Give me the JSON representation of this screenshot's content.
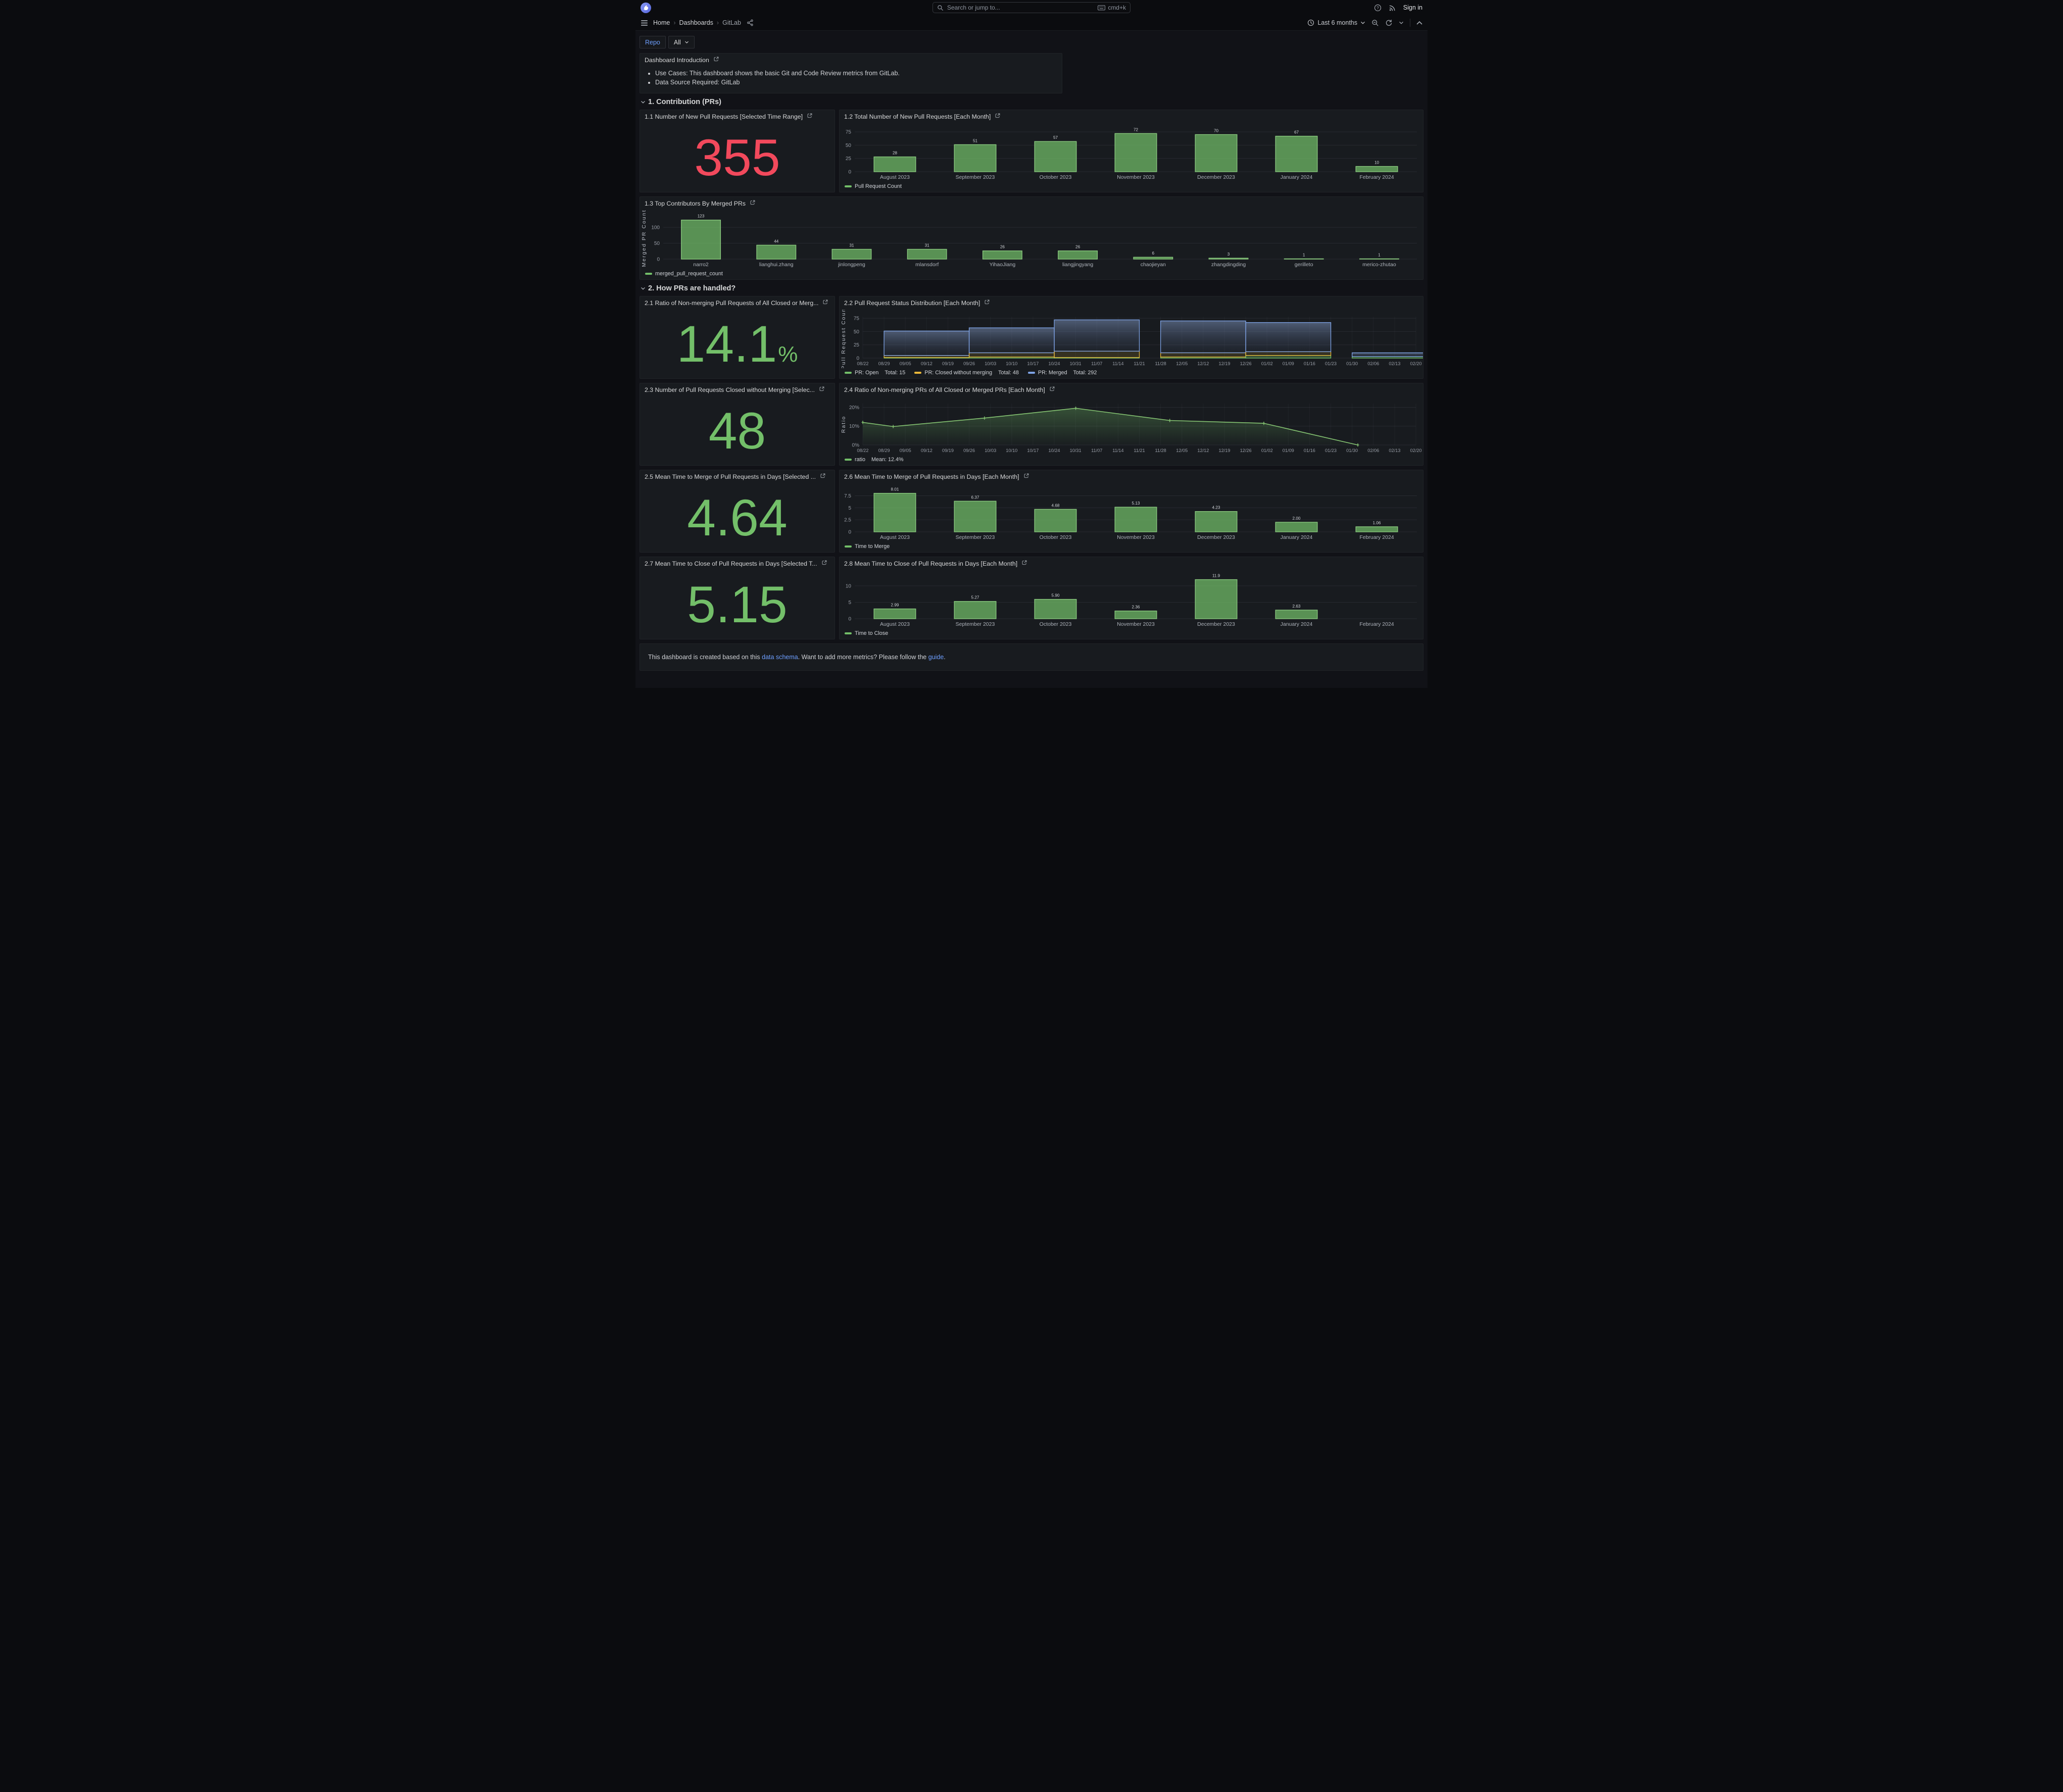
{
  "theme": {
    "page_bg": "#111217",
    "panel_bg": "#181b1f",
    "accent_blue": "#6E9FFF",
    "stat_red": "#F2495C",
    "stat_green": "#73BF69",
    "yellow": "#EAB839",
    "blue_series": "#7EA3E6"
  },
  "topnav": {
    "search_placeholder": "Search or jump to...",
    "shortcut": "cmd+k",
    "sign_in": "Sign in"
  },
  "breadcrumb": {
    "items": [
      "Home",
      "Dashboards",
      "GitLab"
    ]
  },
  "toolbar": {
    "time_range": "Last 6 months"
  },
  "filters": {
    "label": "Repo",
    "value": "All"
  },
  "intro": {
    "title": "Dashboard Introduction",
    "bullets": [
      "Use Cases: This dashboard shows the basic Git and Code Review metrics from GitLab.",
      "Data Source Required: GitLab"
    ]
  },
  "sections": {
    "s1": "1. Contribution (PRs)",
    "s2": "2. How PRs are handled?"
  },
  "stats": {
    "p11": {
      "title": "1.1 Number of New Pull Requests [Selected Time Range]",
      "value": "355"
    },
    "p21": {
      "title": "2.1 Ratio of Non-merging Pull Requests of All Closed or Merg...",
      "value": "14.1",
      "suffix": "%"
    },
    "p23": {
      "title": "2.3 Number of Pull Requests Closed without Merging [Selec...",
      "value": "48"
    },
    "p25": {
      "title": "2.5 Mean Time to Merge of Pull Requests in Days [Selected ...",
      "value": "4.64"
    },
    "p27": {
      "title": "2.7 Mean Time to Close of Pull Requests in Days [Selected T...",
      "value": "5.15"
    }
  },
  "footer": {
    "t1": "This dashboard is created based on this ",
    "l1": "data schema",
    "t2": ". Want to add more metrics? Please follow the ",
    "l2": "guide",
    "t3": "."
  },
  "chart_data": [
    {
      "id": "c12",
      "type": "bar",
      "title": "1.2 Total Number of New Pull Requests [Each Month]",
      "categories": [
        "August 2023",
        "September 2023",
        "October 2023",
        "November 2023",
        "December 2023",
        "January 2024",
        "February 2024"
      ],
      "values": [
        28,
        51,
        57,
        72,
        70,
        67,
        10
      ],
      "labels": [
        "28",
        "51",
        "57",
        "72",
        "70",
        "67",
        "10"
      ],
      "ylim": [
        0,
        78
      ],
      "yticks": [
        0,
        25,
        50,
        75
      ],
      "fill": "rgba(115,191,105,0.72)",
      "stroke": "#8CCB80",
      "legend": [
        {
          "label": "Pull Request Count",
          "color": "#73BF69"
        }
      ]
    },
    {
      "id": "c13",
      "type": "bar",
      "title": "1.3 Top Contributors By Merged PRs",
      "ylabel": "Merged PR Count",
      "categories": [
        "narro2",
        "lianghui.zhang",
        "jinlongpeng",
        "mlansdorf",
        "YihaoJiang",
        "liangjingyang",
        "chaojieyan",
        "zhangdingding",
        "gerilleto",
        "merico-zhutao"
      ],
      "values": [
        123,
        44,
        31,
        31,
        26,
        26,
        6,
        3,
        1,
        1
      ],
      "labels": [
        "123",
        "44",
        "31",
        "31",
        "26",
        "26",
        "6",
        "3",
        "1",
        "1"
      ],
      "ylim": [
        0,
        132
      ],
      "yticks": [
        0,
        50,
        100
      ],
      "fill": "rgba(115,191,105,0.72)",
      "stroke": "#8CCB80",
      "legend": [
        {
          "label": "merged_pull_request_count",
          "color": "#73BF69"
        }
      ]
    },
    {
      "id": "c22",
      "type": "stacked_bar",
      "title": "2.2 Pull Request Status Distribution [Each Month]",
      "ylabel": "Pull Request Count",
      "ylim": [
        0,
        78
      ],
      "yticks": [
        0,
        25,
        50,
        75
      ],
      "bar_span": 4,
      "xticks": [
        "08/22",
        "08/29",
        "09/05",
        "09/12",
        "09/19",
        "09/26",
        "10/03",
        "10/10",
        "10/17",
        "10/24",
        "10/31",
        "11/07",
        "11/14",
        "11/21",
        "11/28",
        "12/05",
        "12/12",
        "12/19",
        "12/26",
        "01/02",
        "01/09",
        "01/16",
        "01/23",
        "01/30",
        "02/06",
        "02/13",
        "02/20"
      ],
      "series": [
        {
          "key": "open",
          "name": "PR: Open",
          "total": "Total: 15",
          "color": "#73BF69",
          "fill": "rgba(115,191,105,0.30)"
        },
        {
          "key": "closed",
          "name": "PR: Closed without merging",
          "total": "Total: 48",
          "color": "#EAB839",
          "fill": "rgba(234,184,57,0.14)"
        },
        {
          "key": "merged",
          "name": "PR: Merged",
          "total": "Total: 292",
          "color": "#7EA3E6",
          "fill": "gradient"
        }
      ],
      "bars": [
        {
          "center": 3,
          "open": 1,
          "closed": 4,
          "merged": 46
        },
        {
          "center": 7,
          "open": 2,
          "closed": 8,
          "merged": 47
        },
        {
          "center": 11,
          "open": 1,
          "closed": 12,
          "merged": 59
        },
        {
          "center": 16,
          "open": 2,
          "closed": 8,
          "merged": 60
        },
        {
          "center": 20,
          "open": 5,
          "closed": 7,
          "merged": 55
        },
        {
          "center": 25,
          "open": 3,
          "closed": 0,
          "merged": 7
        }
      ]
    },
    {
      "id": "c24",
      "type": "area",
      "title": "2.4 Ratio of Non-merging PRs of All Closed or Merged PRs [Each Month]",
      "ylabel": "Ratio",
      "ylim": [
        0,
        22
      ],
      "yticks": [
        0,
        10,
        20
      ],
      "ytick_suffix": "%",
      "xticks": [
        "08/22",
        "08/29",
        "09/05",
        "09/12",
        "09/19",
        "09/26",
        "10/03",
        "10/10",
        "10/17",
        "10/24",
        "10/31",
        "11/07",
        "11/14",
        "11/21",
        "11/28",
        "12/05",
        "12/12",
        "12/19",
        "12/26",
        "01/02",
        "01/09",
        "01/16",
        "01/23",
        "01/30",
        "02/06",
        "02/13",
        "02/20"
      ],
      "points": [
        {
          "x": 0.0,
          "y": 12.0
        },
        {
          "x": 0.055,
          "y": 9.8
        },
        {
          "x": 0.22,
          "y": 14.3
        },
        {
          "x": 0.385,
          "y": 19.5
        },
        {
          "x": 0.555,
          "y": 13.0
        },
        {
          "x": 0.725,
          "y": 11.5
        },
        {
          "x": 0.895,
          "y": 0.0
        }
      ],
      "stroke": "#86c573",
      "legend": [
        {
          "label": "ratio",
          "total": "Mean: 12.4%",
          "color": "#73BF69"
        }
      ]
    },
    {
      "id": "c26",
      "type": "bar",
      "title": "2.6 Mean Time to Merge of Pull Requests in Days [Each Month]",
      "categories": [
        "August 2023",
        "September 2023",
        "October 2023",
        "November 2023",
        "December 2023",
        "January 2024",
        "February 2024"
      ],
      "values": [
        8.01,
        6.37,
        4.68,
        5.13,
        4.23,
        2.0,
        1.06
      ],
      "labels": [
        "8.01",
        "6.37",
        "4.68",
        "5.13",
        "4.23",
        "2.00",
        "1.06"
      ],
      "ylim": [
        0,
        8.6
      ],
      "yticks": [
        0,
        2.5,
        5,
        7.5
      ],
      "fill": "rgba(115,191,105,0.72)",
      "stroke": "#8CCB80",
      "legend": [
        {
          "label": "Time to Merge",
          "color": "#73BF69"
        }
      ]
    },
    {
      "id": "c28",
      "type": "bar",
      "title": "2.8 Mean Time to Close of Pull Requests in Days [Each Month]",
      "categories": [
        "August 2023",
        "September 2023",
        "October 2023",
        "November 2023",
        "December 2023",
        "January 2024",
        "February 2024"
      ],
      "values": [
        2.99,
        5.27,
        5.9,
        2.36,
        11.9,
        2.63,
        null
      ],
      "labels": [
        "2.99",
        "5.27",
        "5.90",
        "2.36",
        "11.9",
        "2.63",
        ""
      ],
      "ylim": [
        0,
        12.6
      ],
      "yticks": [
        0,
        5,
        10
      ],
      "fill": "rgba(115,191,105,0.72)",
      "stroke": "#8CCB80",
      "legend": [
        {
          "label": "Time to Close",
          "color": "#73BF69"
        }
      ]
    }
  ]
}
